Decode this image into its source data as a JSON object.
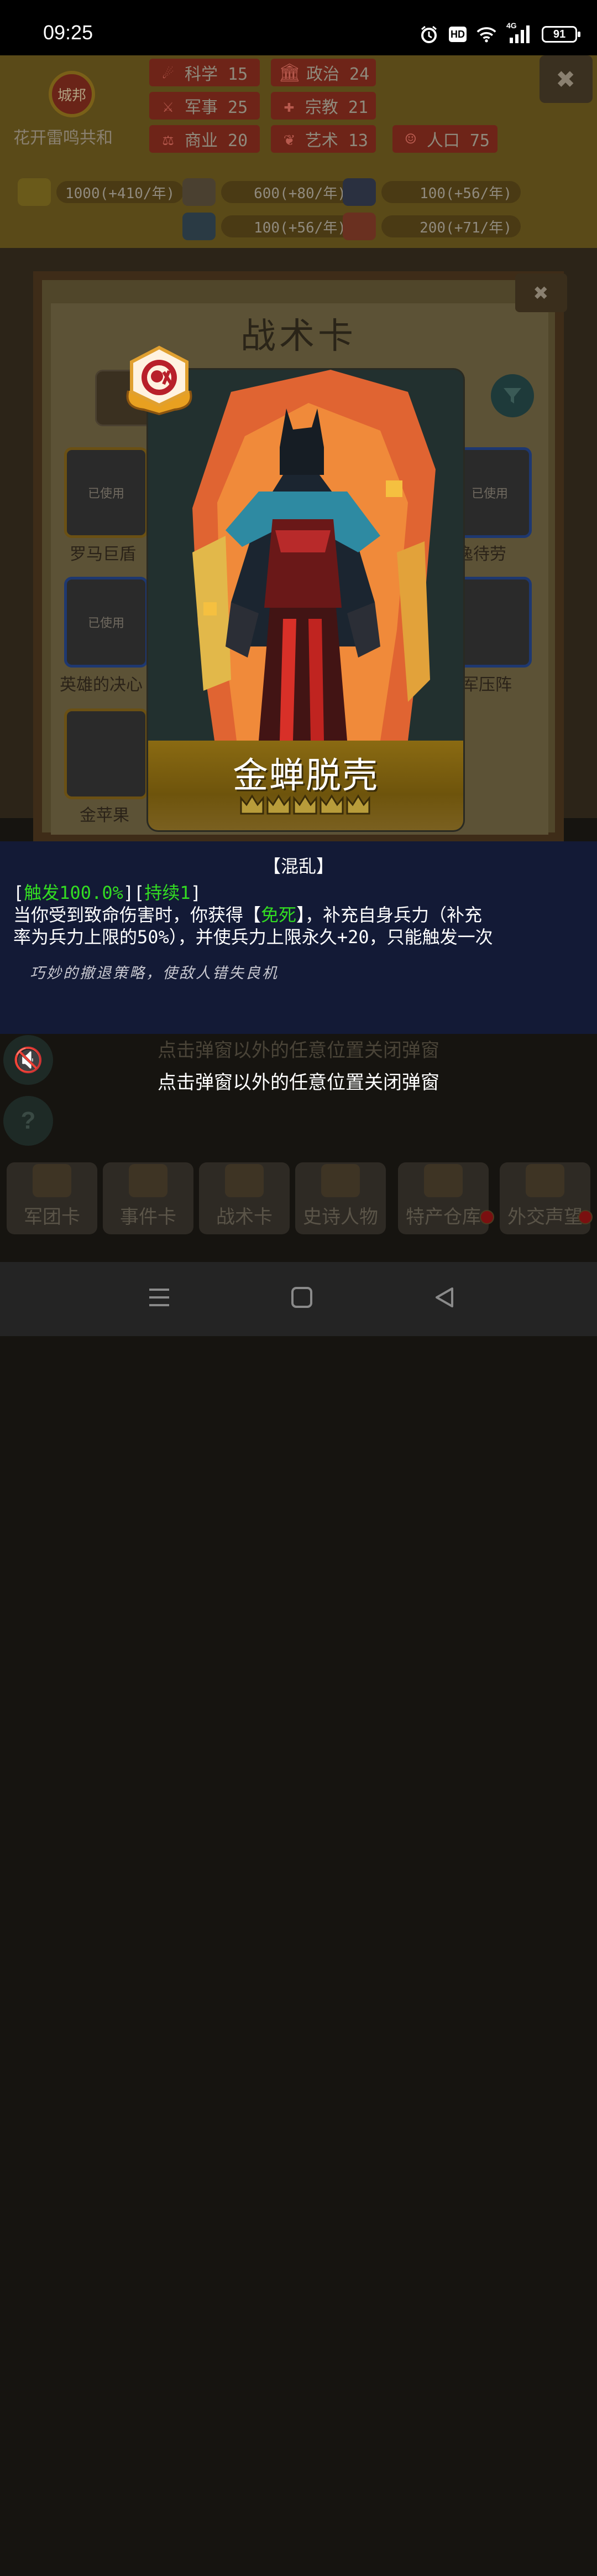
{
  "status_bar": {
    "time": "09:25",
    "alarm_icon": "alarm-clock-icon",
    "hd_label": "HD",
    "network_label": "4G",
    "battery": "91"
  },
  "top_bar": {
    "emblem_label": "城邦",
    "country_name": "花开雷鸣共和",
    "stats": [
      {
        "icon": "science-icon",
        "label": "科学 15"
      },
      {
        "icon": "politics-icon",
        "label": "政治 24"
      },
      {
        "icon": "military-icon",
        "label": "军事 25"
      },
      {
        "icon": "religion-icon",
        "label": "宗教 21"
      },
      {
        "icon": "commerce-icon",
        "label": "商业 20"
      },
      {
        "icon": "art-icon",
        "label": "艺术 13"
      },
      {
        "icon": "population-icon",
        "label": "人口 75"
      }
    ],
    "resources": [
      {
        "icon": "gold-icon",
        "label": "1000(+410/年)"
      },
      {
        "icon": "wood-icon",
        "label": "600(+80/年)"
      },
      {
        "icon": "iron-icon",
        "label": "100(+56/年)"
      },
      {
        "icon": "stone-icon",
        "label": "100(+56/年)"
      },
      {
        "icon": "meat-icon",
        "label": "200(+71/年)"
      }
    ]
  },
  "tactics_panel": {
    "title": "战术卡",
    "slots": [
      {
        "status": "已使用",
        "label": "罗马巨盾"
      },
      {
        "status": "已使用",
        "label": "以逸待劳"
      },
      {
        "status": "已使用",
        "label": "英雄的决心"
      },
      {
        "status": "",
        "label": "大军压阵"
      },
      {
        "status": "",
        "label": "金苹果"
      }
    ]
  },
  "popup": {
    "card_name": "金蝉脱壳",
    "card_rank_stars": 5,
    "desc_title": "【混乱】",
    "trigger_open": "[",
    "trigger_text": "触发100.0%",
    "duration_mid": "][",
    "duration_text": "持续1",
    "duration_close": "]",
    "effect_line1_a": "当你受到致命伤害时，你获得【",
    "effect_keyword": "免死",
    "effect_line1_b": "】，补充自身兵力（补充",
    "effect_line2": "率为兵力上限的50%），并使兵力上限永久+20，只能触发一次",
    "flavor": "巧妙的撤退策略，使敌人错失良机",
    "close_hint": "点击弹窗以外的任意位置关闭弹窗"
  },
  "bottom_tabs": [
    {
      "icon": "helmet-icon",
      "label": "军团卡"
    },
    {
      "icon": "scroll-icon",
      "label": "事件卡"
    },
    {
      "icon": "crossed-swords-icon",
      "label": "战术卡"
    },
    {
      "icon": "crown-icon",
      "label": "史诗人物"
    },
    {
      "icon": "treasure-chest-icon",
      "label": "特产仓库"
    },
    {
      "icon": "envelope-icon",
      "label": "外交声望"
    }
  ],
  "colors": {
    "highlight_green": "#33dd22",
    "desc_panel_bg": "#131a36",
    "card_band_gold": "#7a6010"
  }
}
